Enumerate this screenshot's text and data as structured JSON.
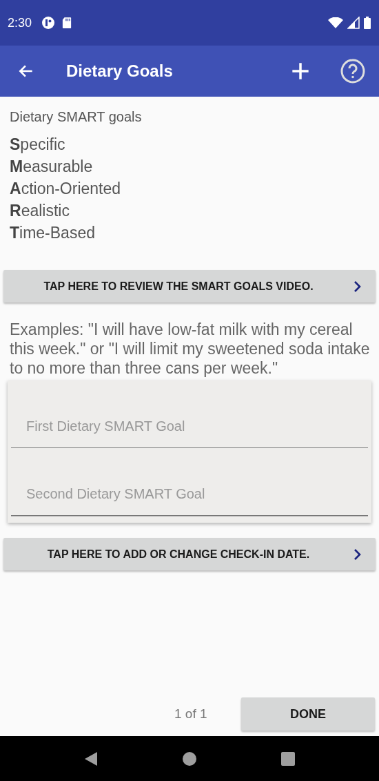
{
  "status_bar": {
    "time": "2:30"
  },
  "app_bar": {
    "title": "Dietary Goals"
  },
  "heading": "Dietary SMART goals",
  "smart_items": [
    "**S**pecific",
    "**M**easurable",
    "**A**ction-Oriented",
    "**R**ealistic",
    "**T**ime-Based"
  ],
  "video_button": {
    "label": "TAP HERE TO REVIEW THE SMART GOALS VIDEO."
  },
  "examples": "Examples: \"I will have low-fat milk with my cereal this week.\" or \"I will limit my sweetened soda intake to no more than three cans per week.\"",
  "goal_fields": [
    {
      "placeholder": "First Dietary SMART Goal"
    },
    {
      "placeholder": "Second Dietary SMART Goal"
    }
  ],
  "checkin_button": {
    "label": "TAP HERE TO ADD OR CHANGE CHECK-IN DATE."
  },
  "footer": {
    "page_indicator": "1 of 1",
    "done_button": "DONE"
  }
}
